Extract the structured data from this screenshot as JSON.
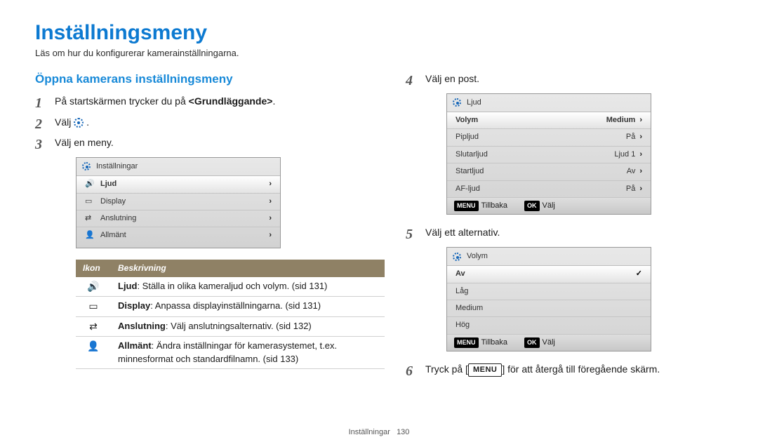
{
  "page_title": "Inställningsmeny",
  "intro": "Läs om hur du konfigurerar kamerainställningarna.",
  "section_title": "Öppna kamerans inställningsmeny",
  "steps": {
    "s1": {
      "num": "1",
      "pre": "På startskärmen trycker du på ",
      "bold": "<Grundläggande>",
      "post": "."
    },
    "s2": {
      "num": "2",
      "pre": "Välj ",
      "post": " ."
    },
    "s3": {
      "num": "3",
      "text": "Välj en meny."
    },
    "s4": {
      "num": "4",
      "text": "Välj en post."
    },
    "s5": {
      "num": "5",
      "text": "Välj ett alternativ."
    },
    "s6": {
      "num": "6",
      "pre": "Tryck på [",
      "btn": "MENU",
      "post": "] för att återgå till föregående skärm."
    }
  },
  "cam1": {
    "header": "Inställningar",
    "rows": [
      {
        "icon": "🔊",
        "label": "Ljud"
      },
      {
        "icon": "▭",
        "label": "Display"
      },
      {
        "icon": "⇄",
        "label": "Anslutning"
      },
      {
        "icon": "👤",
        "label": "Allmänt"
      }
    ]
  },
  "cam2": {
    "header": "Ljud",
    "rows": [
      {
        "label": "Volym",
        "value": "Medium"
      },
      {
        "label": "Pipljud",
        "value": "På"
      },
      {
        "label": "Slutarljud",
        "value": "Ljud 1"
      },
      {
        "label": "Startljud",
        "value": "Av"
      },
      {
        "label": "AF-ljud",
        "value": "På"
      }
    ],
    "footer_back_tag": "MENU",
    "footer_back_label": "Tillbaka",
    "footer_ok_tag": "OK",
    "footer_ok_label": "Välj"
  },
  "cam3": {
    "header": "Volym",
    "rows": [
      {
        "label": "Av",
        "selected": true
      },
      {
        "label": "Låg"
      },
      {
        "label": "Medium"
      },
      {
        "label": "Hög"
      }
    ],
    "footer_back_tag": "MENU",
    "footer_back_label": "Tillbaka",
    "footer_ok_tag": "OK",
    "footer_ok_label": "Välj"
  },
  "legend": {
    "head_icon": "Ikon",
    "head_desc": "Beskrivning",
    "rows": [
      {
        "icon": "🔊",
        "bold": "Ljud",
        "text": ": Ställa in olika kameraljud och volym. (sid 131)"
      },
      {
        "icon": "▭",
        "bold": "Display",
        "text": ": Anpassa displayinställningarna. (sid 131)"
      },
      {
        "icon": "⇄",
        "bold": "Anslutning",
        "text": ": Välj anslutningsalternativ. (sid 132)"
      },
      {
        "icon": "👤",
        "bold": "Allmänt",
        "text": ": Ändra inställningar för kamerasystemet, t.ex. minnesformat och standardfilnamn. (sid 133)"
      }
    ]
  },
  "footer_section": "Inställningar",
  "footer_page": "130"
}
